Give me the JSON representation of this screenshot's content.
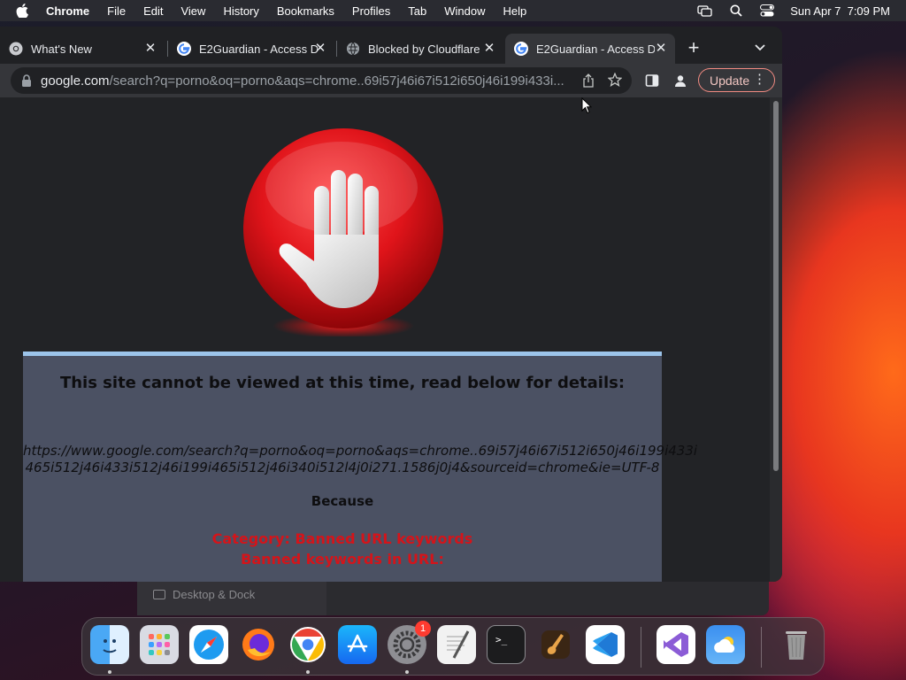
{
  "menubar": {
    "app_name": "Chrome",
    "items": [
      "File",
      "Edit",
      "View",
      "History",
      "Bookmarks",
      "Profiles",
      "Tab",
      "Window",
      "Help"
    ],
    "datetime": "Sun Apr 7  7:09 PM"
  },
  "tabs": [
    {
      "title": "What's New",
      "favicon": "chrome-icon",
      "active": false
    },
    {
      "title": "E2Guardian - Access D",
      "favicon": "google-icon",
      "active": false
    },
    {
      "title": "Blocked by Cloudflare",
      "favicon": "globe-icon",
      "active": false
    },
    {
      "title": "E2Guardian - Access D",
      "favicon": "google-icon",
      "active": true
    }
  ],
  "omnibox": {
    "host": "google.com",
    "path": "/search?q=porno&oq=porno&aqs=chrome..69i57j46i67i512i650j46i199i433i..."
  },
  "toolbar": {
    "update_label": "Update"
  },
  "page": {
    "heading": "This site cannot be viewed at this time, read below for details:",
    "blocked_url_line1": "https://www.google.com/search?q=porno&oq=porno&aqs=chrome..69i57j46i67i512i650j46i199i433i",
    "blocked_url_line2": "465i512j46i433i512j46i199i465i512j46i340i512l4j0i271.1586j0j4&sourceid=chrome&ie=UTF-8",
    "because": "Because",
    "reason_line1": "Category: Banned URL keywords",
    "reason_line2": "Banned keywords in URL:"
  },
  "behind_window": {
    "sidebar_item": "Desktop & Dock"
  },
  "dock": {
    "apps": [
      "Finder",
      "Launchpad",
      "Safari",
      "Firefox",
      "Google Chrome",
      "App Store",
      "System Settings",
      "TextEdit",
      "Terminal",
      "GarageBand",
      "Visual Studio Code",
      "Visual Studio",
      "Weather",
      "Trash"
    ],
    "system_settings_badge": "1"
  },
  "colors": {
    "panel_bg": "#4b5163",
    "panel_top_border": "#9cc4ea",
    "reason_red": "#d4141a",
    "update_border": "#f28b82"
  }
}
